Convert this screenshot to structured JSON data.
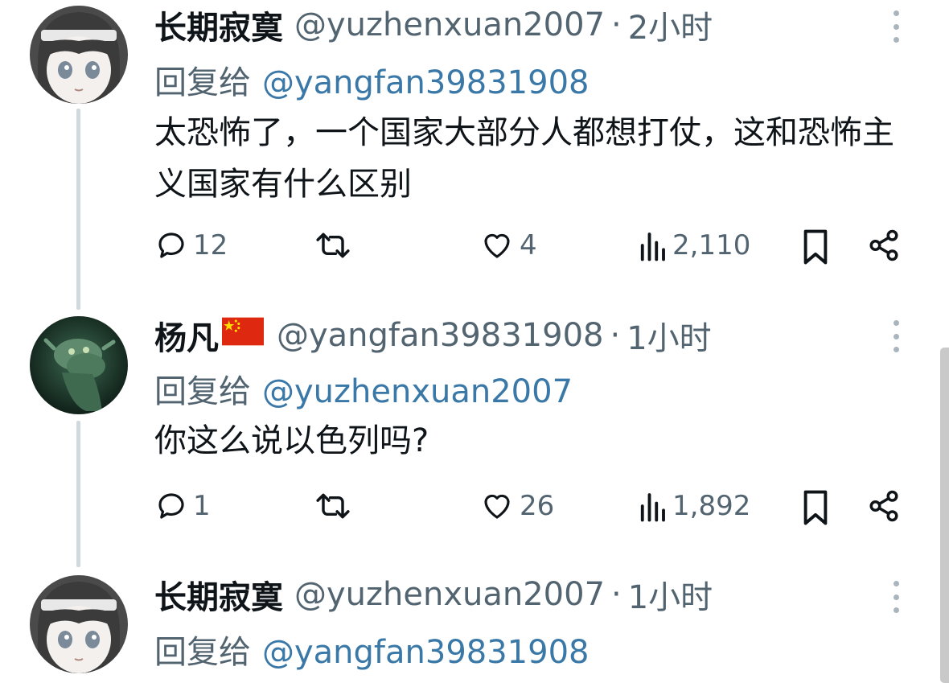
{
  "tweets": [
    {
      "name": "长期寂寞",
      "handle": "@yuzhenxuan2007",
      "dot": "·",
      "time": "2小时",
      "reply_prefix": "回复给",
      "reply_to": "@yangfan39831908",
      "text": "太恐怖了，一个国家大部分人都想打仗，这和恐怖主义国家有什么区别",
      "replies": "12",
      "retweets": "",
      "likes": "4",
      "views": "2,110"
    },
    {
      "name": "杨凡",
      "flag": "🇨🇳",
      "handle": "@yangfan39831908",
      "dot": "·",
      "time": "1小时",
      "reply_prefix": "回复给",
      "reply_to": "@yuzhenxuan2007",
      "text": "你这么说以色列吗?",
      "replies": "1",
      "retweets": "",
      "likes": "26",
      "views": "1,892"
    },
    {
      "name": "长期寂寞",
      "handle": "@yuzhenxuan2007",
      "dot": "·",
      "time": "1小时",
      "reply_prefix": "回复给",
      "reply_to": "@yangfan39831908"
    }
  ],
  "colors": {
    "text": "#0f1419",
    "secondary": "#536471",
    "mention": "#3a78a8",
    "thread_line": "#cfd9de"
  }
}
